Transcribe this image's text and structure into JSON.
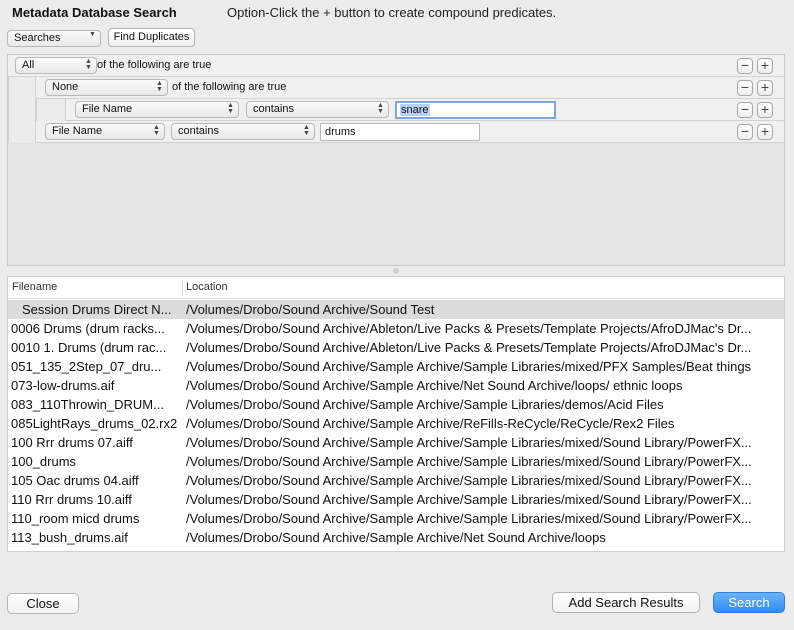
{
  "header": {
    "title": "Metadata Database Search",
    "hint": "Option-Click the + button to create compound predicates."
  },
  "toolbar": {
    "searches_popup": "Searches",
    "find_duplicates": "Find Duplicates"
  },
  "predicates": {
    "row1": {
      "quantifier": "All",
      "text": "of the following are true"
    },
    "row2": {
      "quantifier": "None",
      "text": "of the following are true"
    },
    "row3": {
      "attribute": "File Name",
      "operator": "contains",
      "value": "snare"
    },
    "row4": {
      "attribute": "File Name",
      "operator": "contains",
      "value": "drums"
    },
    "minus": "−",
    "plus": "+"
  },
  "results": {
    "columns": {
      "filename": "Filename",
      "location": "Location"
    },
    "rows": [
      {
        "filename": "Session Drums Direct N...",
        "location": "/Volumes/Drobo/Sound Archive/Sound Test"
      },
      {
        "filename": "0006 Drums (drum racks...",
        "location": "/Volumes/Drobo/Sound Archive/Ableton/Live Packs & Presets/Template Projects/AfroDJMac's Dr..."
      },
      {
        "filename": "0010 1. Drums (drum rac...",
        "location": "/Volumes/Drobo/Sound Archive/Ableton/Live Packs & Presets/Template Projects/AfroDJMac's Dr..."
      },
      {
        "filename": "051_135_2Step_07_dru...",
        "location": "/Volumes/Drobo/Sound Archive/Sample Archive/Sample Libraries/mixed/PFX Samples/Beat things"
      },
      {
        "filename": "073-low-drums.aif",
        "location": "/Volumes/Drobo/Sound Archive/Sample Archive/Net Sound Archive/loops/ ethnic loops"
      },
      {
        "filename": "083_110Throwin_DRUM...",
        "location": "/Volumes/Drobo/Sound Archive/Sample Archive/Sample Libraries/demos/Acid Files"
      },
      {
        "filename": "085LightRays_drums_02.rx2",
        "location": "/Volumes/Drobo/Sound Archive/Sample Archive/ReFills-ReCycle/ReCycle/Rex2 Files"
      },
      {
        "filename": "100 Rrr drums 07.aiff",
        "location": "/Volumes/Drobo/Sound Archive/Sample Archive/Sample Libraries/mixed/Sound Library/PowerFX..."
      },
      {
        "filename": "100_drums",
        "location": "/Volumes/Drobo/Sound Archive/Sample Archive/Sample Libraries/mixed/Sound Library/PowerFX..."
      },
      {
        "filename": "105 Oac drums 04.aiff",
        "location": "/Volumes/Drobo/Sound Archive/Sample Archive/Sample Libraries/mixed/Sound Library/PowerFX..."
      },
      {
        "filename": "110 Rrr drums 10.aiff",
        "location": "/Volumes/Drobo/Sound Archive/Sample Archive/Sample Libraries/mixed/Sound Library/PowerFX..."
      },
      {
        "filename": "110_room micd drums",
        "location": "/Volumes/Drobo/Sound Archive/Sample Archive/Sample Libraries/mixed/Sound Library/PowerFX..."
      },
      {
        "filename": "113_bush_drums.aif",
        "location": "/Volumes/Drobo/Sound Archive/Sample Archive/Net Sound Archive/loops"
      }
    ]
  },
  "footer": {
    "close": "Close",
    "add_search_results": "Add Search Results",
    "search": "Search"
  },
  "colors": {
    "window_bg": "#ececec",
    "accent": "#2f8cf0",
    "selection_row": "#dcdcdc",
    "text_highlight": "#b6d2f4"
  }
}
